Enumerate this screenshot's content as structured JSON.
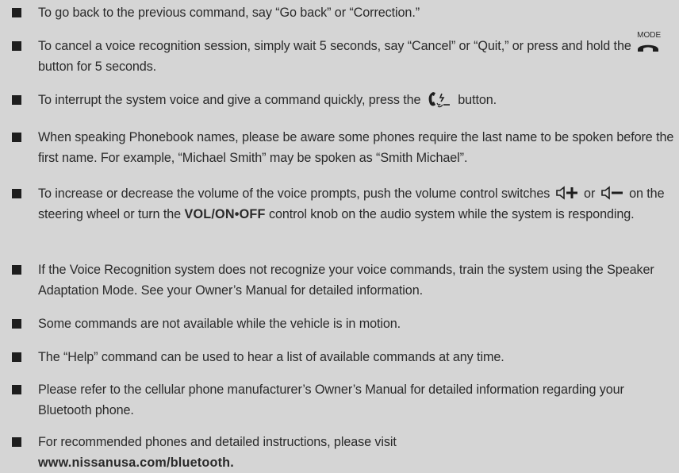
{
  "tips": [
    {
      "text": "To go back to the previous command, say “Go back” or “Correction.”"
    },
    {
      "text_a": "To cancel a voice recognition session, simply wait 5 seconds, say “Cancel” or “Quit,” or press and hold the",
      "icon_label": "MODE",
      "icon_name": "phone-hangup-icon",
      "text_b": "button for 5 seconds."
    },
    {
      "text_a": "To interrupt the system voice and give a command quickly, press the",
      "icon_name": "talk-phone-icon",
      "text_b": "button."
    },
    {
      "text": "When speaking Phonebook names, please be aware some phones require the last name to be spoken before the first name. For example, “Michael Smith” may be spoken as “Smith Michael”."
    },
    {
      "text_a": "To increase or decrease the volume of the voice prompts, push the volume control switches",
      "icon_up": "volume-up-icon",
      "text_or": "or",
      "icon_down": "volume-down-icon",
      "text_b": "on the steering wheel or turn the",
      "bold": "VOL/ON•OFF",
      "text_c": "control knob on the audio system while the system is responding."
    },
    {
      "text": "If the Voice Recognition system does not recognize your voice commands, train the system using the Speaker Adaptation Mode. See your Owner’s Manual for detailed information."
    },
    {
      "text": "Some commands are not available while the vehicle is in motion."
    },
    {
      "text": "The “Help” command can be used to hear a list of available commands at any time."
    },
    {
      "text": "Please refer to the cellular phone manufacturer’s Owner’s Manual for detailed information regarding your Bluetooth phone."
    },
    {
      "text": "For recommended phones and detailed instructions, please visit",
      "link": "www.nissanusa.com/bluetooth."
    }
  ]
}
